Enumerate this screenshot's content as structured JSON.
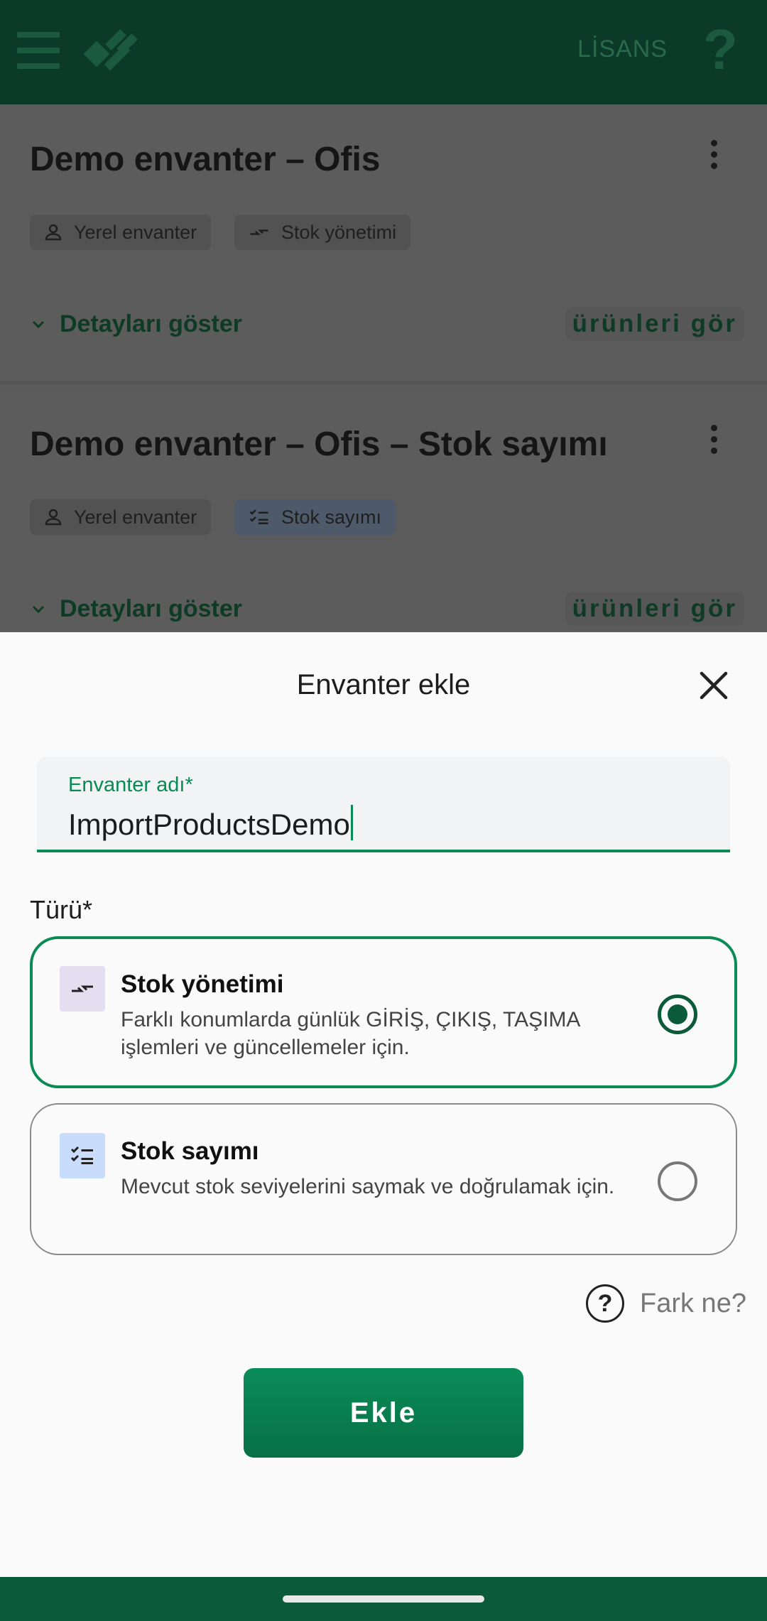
{
  "appbar": {
    "license_label": "LİSANS",
    "help_glyph": "?"
  },
  "inventories": [
    {
      "title": "Demo envanter – Ofis",
      "chips": [
        "Yerel envanter",
        "Stok yönetimi"
      ],
      "details_label": "Detayları göster",
      "products_label": "ürünleri gör"
    },
    {
      "title": "Demo envanter – Ofis – Stok sayımı",
      "chips": [
        "Yerel envanter",
        "Stok sayımı"
      ],
      "details_label": "Detayları göster",
      "products_label": "ürünleri gör"
    }
  ],
  "dialog": {
    "title": "Envanter ekle",
    "name_field": {
      "label": "Envanter adı*",
      "value": "ImportProductsDemo"
    },
    "type_label": "Türü*",
    "options": [
      {
        "title": "Stok yönetimi",
        "description": "Farklı konumlarda günlük GİRİŞ, ÇIKIŞ, TAŞIMA işlemleri ve güncellemeler için.",
        "selected": true,
        "icon": "transfer-arrows-icon"
      },
      {
        "title": "Stok sayımı",
        "description": "Mevcut stok seviyelerini saymak ve doğrulamak için.",
        "selected": false,
        "icon": "checklist-icon"
      }
    ],
    "help_link": "Fark ne?",
    "help_glyph": "?",
    "submit_label": "Ekle"
  },
  "colors": {
    "primary": "#0a8a54",
    "appbar": "#0b3a28",
    "navbar": "#0b5a3a"
  }
}
